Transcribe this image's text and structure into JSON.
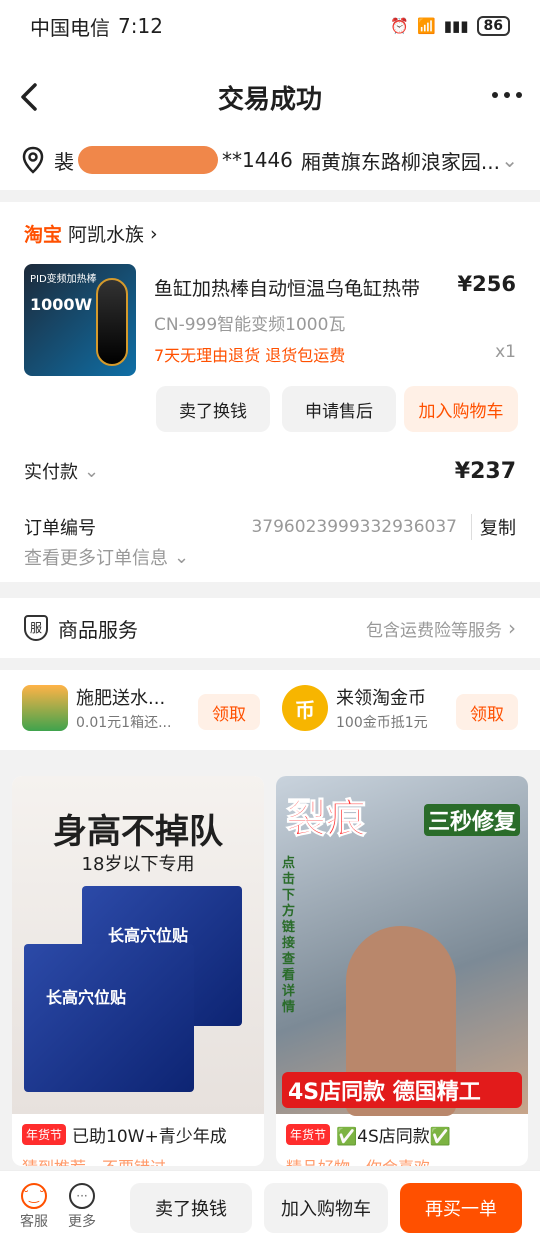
{
  "status": {
    "carrier": "中国电信",
    "time": "7:12",
    "battery": "86"
  },
  "nav": {
    "title": "交易成功"
  },
  "address": {
    "name_prefix": "裴",
    "phone_suffix": "**1446",
    "address": "厢黄旗东路柳浪家园..."
  },
  "shop": {
    "platform": "淘宝",
    "name": "阿凯水族"
  },
  "product": {
    "image_caption": "PID变频加热棒",
    "image_power": "1000W",
    "title": "鱼缸加热棒自动恒温乌龟缸热带",
    "price": "¥256",
    "spec": "CN-999智能变频1000瓦",
    "promo": "7天无理由退货  退货包运费",
    "qty": "x1"
  },
  "actions": {
    "sell": "卖了换钱",
    "after_sale": "申请售后",
    "add_cart": "加入购物车"
  },
  "payment": {
    "label": "实付款",
    "amount": "¥237"
  },
  "order": {
    "label": "订单编号",
    "number": "3796023999332936037",
    "copy": "复制",
    "more": "查看更多订单信息"
  },
  "services": {
    "icon_text": "服",
    "title": "商品服务",
    "desc": "包含运费险等服务"
  },
  "benefits": [
    {
      "title": "施肥送水...",
      "sub": "0.01元1箱还...",
      "btn": "领取"
    },
    {
      "icon_text": "币",
      "title": "来领淘金币",
      "sub": "100金币抵1元",
      "btn": "领取"
    }
  ],
  "feed": [
    {
      "headline": "身高不掉队",
      "subline": "18岁以下专用",
      "box_text": "长高穴位贴",
      "tag": "年货节",
      "caption": "已助10W+青少年成",
      "sub": "猜到推荐，不要错过"
    },
    {
      "headline": "裂痕",
      "subline": "三秒修复",
      "side": "点击下方链接查看详情",
      "bottom": "4S店同款 德国精工",
      "tag": "年货节",
      "caption": "✅4S店同款✅",
      "sub": "精品好物，你会喜欢"
    }
  ],
  "bottom": {
    "service": "客服",
    "more": "更多",
    "sell": "卖了换钱",
    "add_cart": "加入购物车",
    "rebuy": "再买一单"
  },
  "colors": {
    "accent": "#ff5000",
    "bg": "#f2f2f2"
  }
}
